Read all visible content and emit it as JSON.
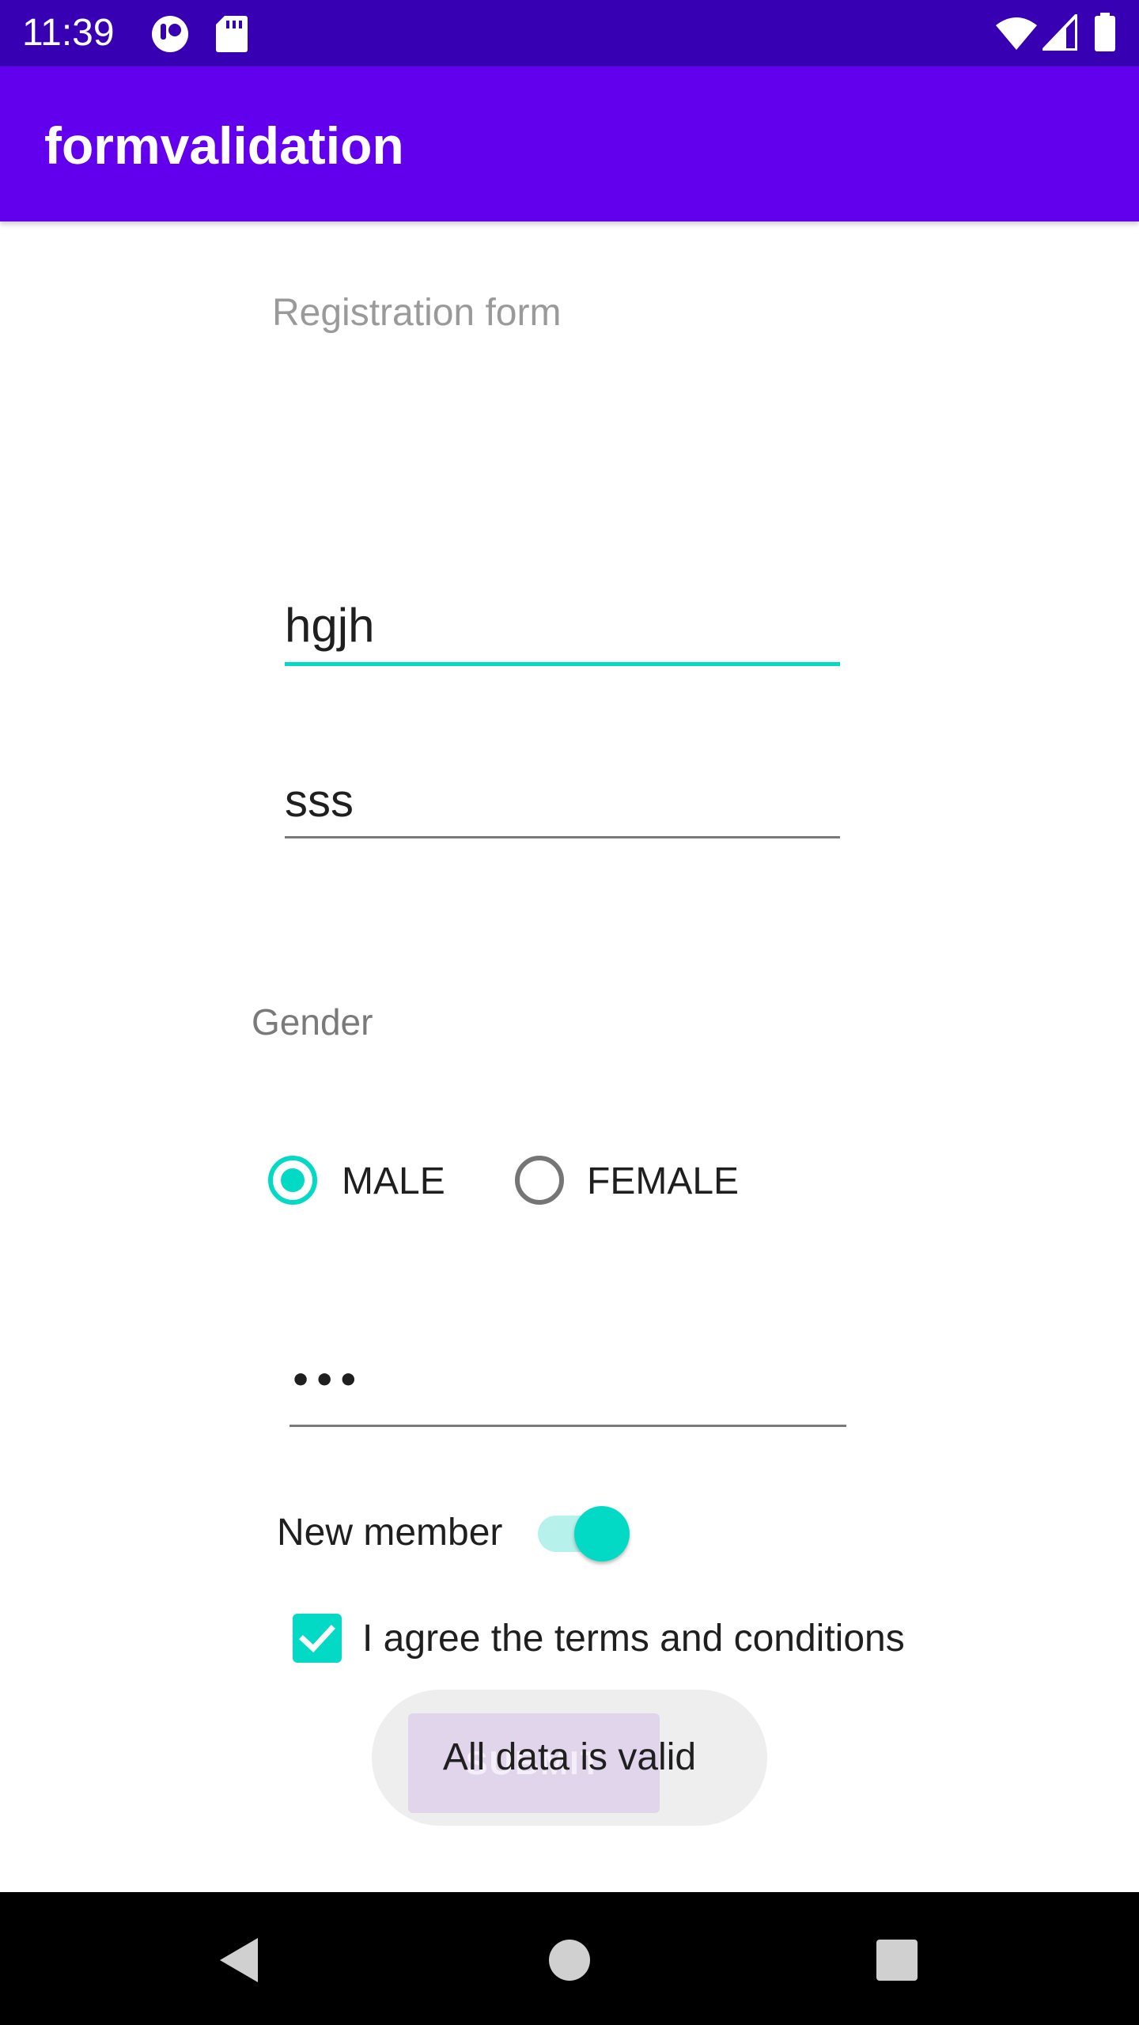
{
  "status_bar": {
    "time": "11:39",
    "icons": [
      "notification-app-icon",
      "sd-card-icon",
      "wifi-icon",
      "cellular-signal-icon",
      "battery-icon"
    ],
    "background_color": "#3700B3"
  },
  "app_bar": {
    "title": "formvalidation",
    "background_color": "#6200EE"
  },
  "form": {
    "title": "Registration form",
    "name_field_value": "hgjh",
    "email_field_value": "sss",
    "gender_label": "Gender",
    "gender_options": [
      {
        "label": "MALE",
        "checked": true
      },
      {
        "label": "FEMALE",
        "checked": false
      }
    ],
    "password_display": "•••",
    "new_member_label": "New member",
    "new_member_on": true,
    "terms_label": "I agree the terms and conditions",
    "terms_checked": true,
    "submit_label": "SUBMIT",
    "accent_color": "#03DAC5"
  },
  "toast": {
    "message": "All data is valid"
  },
  "nav_bar": {
    "buttons": [
      "back-icon",
      "home-icon",
      "recents-icon"
    ]
  }
}
